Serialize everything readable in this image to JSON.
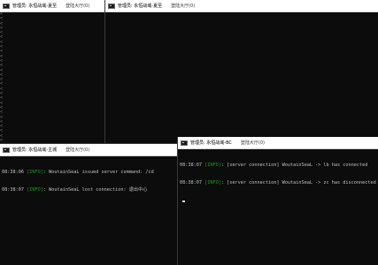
{
  "windows": [
    {
      "title": "管理员: 永恒战域-夏至",
      "extra": "登陆大厅(0)",
      "lines": []
    },
    {
      "title": "管理员: 永恒战域-夏至",
      "extra": "登陆大厅(0)",
      "lines": []
    },
    {
      "title": "管理员: 永恒战域-主城",
      "extra": "登陆大厅(0)",
      "lines": [
        {
          "time": "08:38:06",
          "level": "[INFO]",
          "text": ": WoutainSeaL issued server command: /cd"
        },
        {
          "time": "08:38:07",
          "level": "[INFO]",
          "text": ": WoutainSeaL lost connection: 退出中心"
        }
      ]
    },
    {
      "title": "管理员: 永恒战域-BC",
      "extra": "登陆大厅(0)",
      "lines": [
        {
          "time": "08:38:07",
          "level": "[INFO]",
          "text": ": [server connection] WoutainSeaL -> lb has connected"
        },
        {
          "time": "08:38:07",
          "level": "[INFO]",
          "text": ": [server connection] WoutainSeaL -> zc has disconnected"
        }
      ]
    }
  ],
  "gutter_marker": "<",
  "colors": {
    "titlebar_bg": "#ffffff",
    "console_bg": "#0c0c0c",
    "console_text": "#c0c0c0",
    "info_text": "#13a10e"
  }
}
